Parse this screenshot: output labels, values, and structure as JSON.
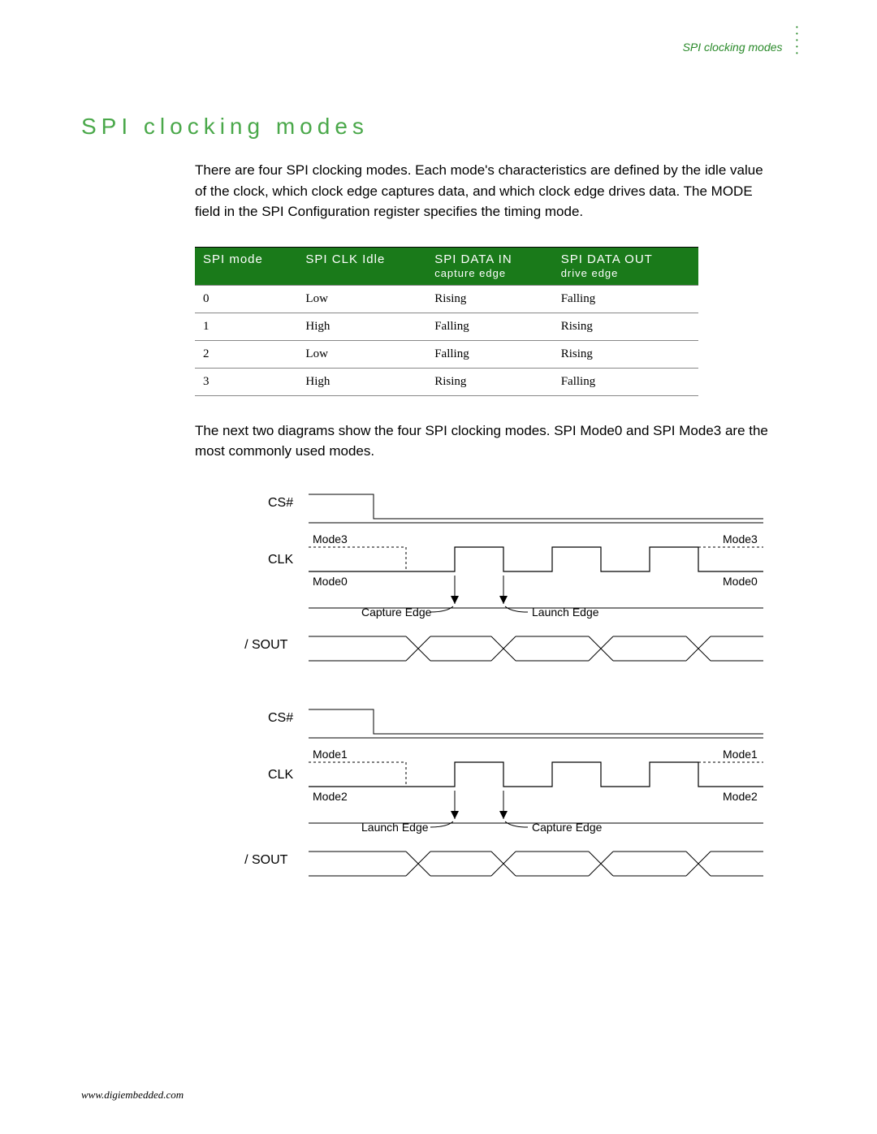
{
  "header": {
    "corner_label": "SPI clocking modes"
  },
  "heading": "SPI clocking modes",
  "intro": "There are four SPI clocking modes. Each mode's characteristics are defined by the idle value of the clock, which clock edge captures data, and which clock edge drives data. The MODE field in the SPI Configuration register specifies the timing mode.",
  "table": {
    "headers": {
      "c0": "SPI mode",
      "c1": "SPI CLK Idle",
      "c2_l1": "SPI DATA IN",
      "c2_l2": "capture edge",
      "c3_l1": "SPI DATA OUT",
      "c3_l2": "drive edge"
    },
    "rows": [
      {
        "mode": "0",
        "idle": "Low",
        "cap": "Rising",
        "drv": "Falling"
      },
      {
        "mode": "1",
        "idle": "High",
        "cap": "Falling",
        "drv": "Rising"
      },
      {
        "mode": "2",
        "idle": "Low",
        "cap": "Falling",
        "drv": "Rising"
      },
      {
        "mode": "3",
        "idle": "High",
        "cap": "Rising",
        "drv": "Falling"
      }
    ]
  },
  "mid_text": "The next two diagrams show the four SPI clocking modes. SPI Mode0 and SPI Mode3 are the most commonly used modes.",
  "diagram1": {
    "cs": "CS#",
    "clk": "CLK",
    "sin_sout": "SIN / SOUT",
    "mode_top_l": "Mode3",
    "mode_top_r": "Mode3",
    "mode_bot_l": "Mode0",
    "mode_bot_r": "Mode0",
    "edge_left": "Capture Edge",
    "edge_right": "Launch Edge"
  },
  "diagram2": {
    "cs": "CS#",
    "clk": "CLK",
    "sin_sout": "SIN / SOUT",
    "mode_top_l": "Mode1",
    "mode_top_r": "Mode1",
    "mode_bot_l": "Mode2",
    "mode_bot_r": "Mode2",
    "edge_left": "Launch Edge",
    "edge_right": "Capture Edge"
  },
  "footer": "www.digiembedded.com"
}
